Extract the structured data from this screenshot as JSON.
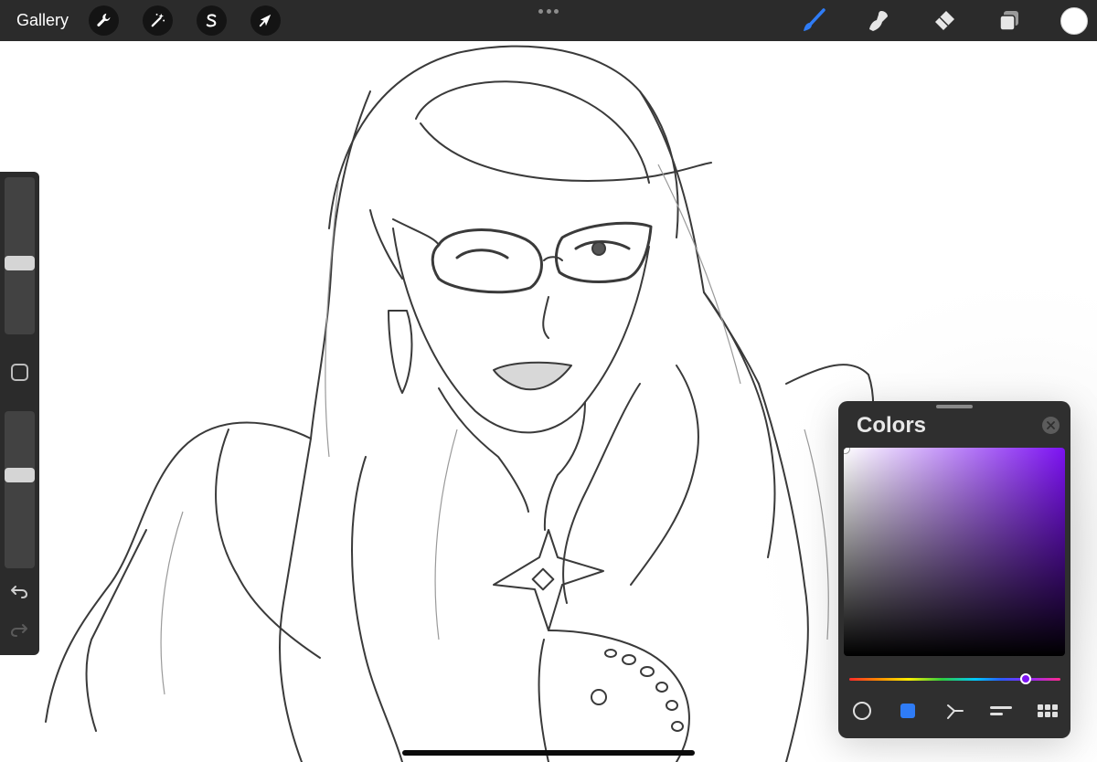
{
  "topbar": {
    "gallery_label": "Gallery",
    "left_tools": [
      {
        "name": "actions",
        "icon": "wrench-icon"
      },
      {
        "name": "adjustments",
        "icon": "magic-wand-icon"
      },
      {
        "name": "selection",
        "icon": "selection-s-icon"
      },
      {
        "name": "transform",
        "icon": "arrow-cursor-icon"
      }
    ],
    "more_icon": "more-dots-icon",
    "right_tools": [
      {
        "name": "brush",
        "icon": "brush-icon",
        "active": true
      },
      {
        "name": "smudge",
        "icon": "smudge-icon",
        "active": false
      },
      {
        "name": "eraser",
        "icon": "eraser-icon",
        "active": false
      },
      {
        "name": "layers",
        "icon": "layers-icon",
        "active": false
      }
    ],
    "current_color": "#ffffff"
  },
  "sidebar": {
    "brush_size_level": 0.45,
    "opacity_level": 0.6,
    "modify_icon": "square-modify-icon",
    "undo_icon": "undo-icon",
    "redo_icon": "redo-icon"
  },
  "colors_panel": {
    "title": "Colors",
    "close_icon": "close-icon",
    "selected_hue": "#7c12f2",
    "selected_color": "#ffffff",
    "tabs": [
      {
        "name": "disc",
        "icon": "circle-disc-icon",
        "active": false
      },
      {
        "name": "classic",
        "icon": "square-classic-icon",
        "active": true
      },
      {
        "name": "harmony",
        "icon": "harmony-icon",
        "active": false
      },
      {
        "name": "value",
        "icon": "value-bars-icon",
        "active": false
      },
      {
        "name": "palettes",
        "icon": "palette-grid-icon",
        "active": false
      }
    ]
  },
  "accent_color": "#2f7cf6"
}
